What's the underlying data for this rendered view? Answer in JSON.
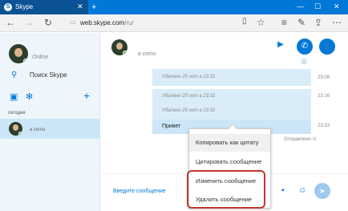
{
  "browser": {
    "tab_title": "Skype",
    "tab_close": "✕",
    "new_tab": "+",
    "url_host": "web.skype.com",
    "url_path": "/ru/",
    "btn_back": "←",
    "btn_forward": "→",
    "btn_refresh": "↻",
    "btn_reading": "▯",
    "btn_favorite": "☆",
    "btn_menu_hub": "≡",
    "btn_notes": "✎",
    "btn_share": "⇪",
    "btn_more": "⋯",
    "win_min": "—",
    "win_max": "☐",
    "win_close": "✕"
  },
  "sidebar": {
    "status": "Online",
    "search_label": "Поиск Skype",
    "section_today": "сегодня",
    "contact_status": "в сети"
  },
  "chat": {
    "header_status": "в сети",
    "messages": [
      {
        "text": "Удалено 25 окт в 23:31",
        "time": "23:09"
      },
      {
        "text": "Удалено 25 окт в 23:31",
        "time": "23:16"
      },
      {
        "text": "Удалено 25 окт в 23:31",
        "time": ""
      },
      {
        "text": "Привет",
        "time": "23:33"
      }
    ],
    "sent_status": "Отправлено",
    "input_placeholder": "Введите сообщение"
  },
  "context_menu": {
    "items": [
      "Копировать как цитату",
      "Цитировать сообщение",
      "Изменить сообщение",
      "Удалить сообщение"
    ]
  }
}
